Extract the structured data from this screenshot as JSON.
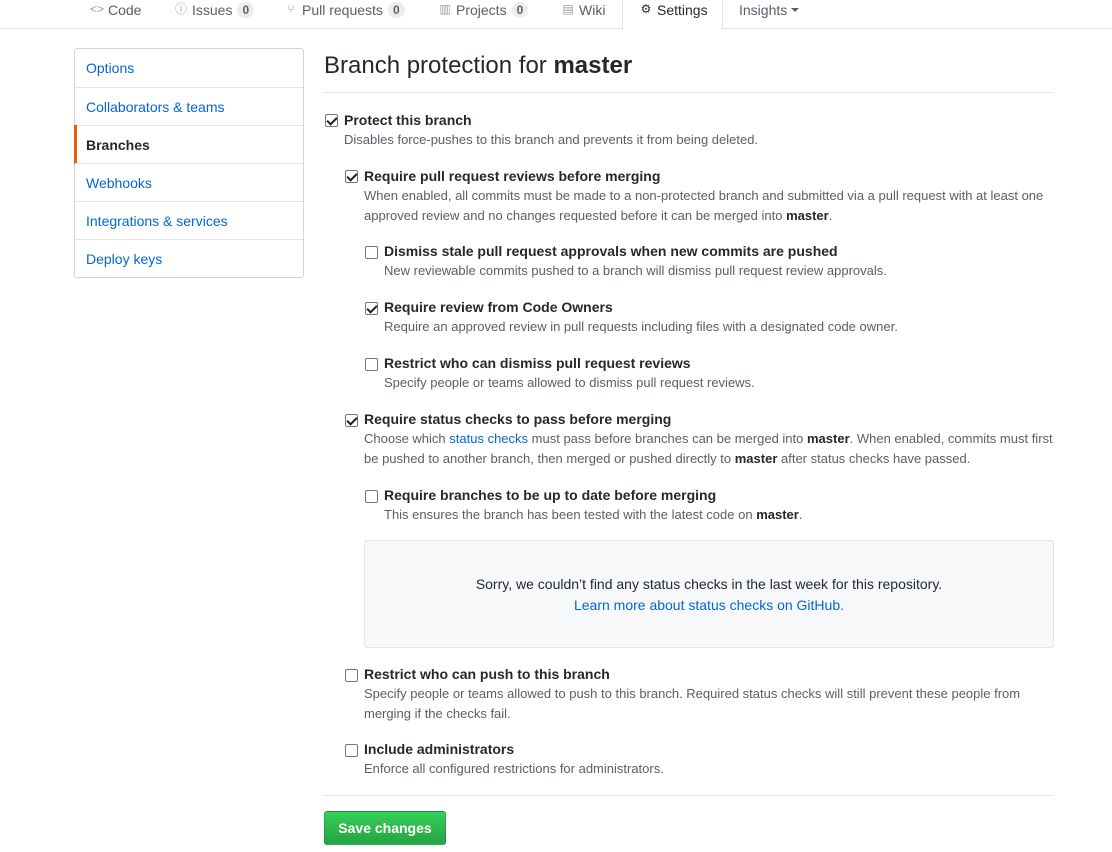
{
  "nav": {
    "tabs": [
      {
        "label": "Code",
        "icon": "code-icon"
      },
      {
        "label": "Issues",
        "icon": "issue-icon",
        "count": "0"
      },
      {
        "label": "Pull requests",
        "icon": "pull-request-icon",
        "count": "0"
      },
      {
        "label": "Projects",
        "icon": "project-icon",
        "count": "0"
      },
      {
        "label": "Wiki",
        "icon": "book-icon"
      },
      {
        "label": "Settings",
        "icon": "gear-icon",
        "selected": true
      },
      {
        "label": "Insights",
        "icon": "chevron-down-icon"
      }
    ]
  },
  "sidebar": {
    "items": [
      {
        "label": "Options"
      },
      {
        "label": "Collaborators & teams"
      },
      {
        "label": "Branches",
        "active": true
      },
      {
        "label": "Webhooks"
      },
      {
        "label": "Integrations & services"
      },
      {
        "label": "Deploy keys"
      }
    ]
  },
  "main": {
    "heading_prefix": "Branch protection for ",
    "heading_branch": "master",
    "options": {
      "protect": {
        "title": "Protect this branch",
        "checked": true,
        "note": "Disables force-pushes to this branch and prevents it from being deleted."
      },
      "reviews": {
        "title": "Require pull request reviews before merging",
        "checked": true,
        "note_a": "When enabled, all commits must be made to a non-protected branch and submitted via a pull request with at least one approved review and no changes requested before it can be merged into ",
        "note_b": "master",
        "note_c": "."
      },
      "dismiss_stale": {
        "title": "Dismiss stale pull request approvals when new commits are pushed",
        "checked": false,
        "note": "New reviewable commits pushed to a branch will dismiss pull request review approvals."
      },
      "code_owners": {
        "title": "Require review from Code Owners",
        "checked": true,
        "note": "Require an approved review in pull requests including files with a designated code owner."
      },
      "restrict_dismiss": {
        "title": "Restrict who can dismiss pull request reviews",
        "checked": false,
        "note": "Specify people or teams allowed to dismiss pull request reviews."
      },
      "status_checks": {
        "title": "Require status checks to pass before merging",
        "checked": true,
        "note_a": "Choose which ",
        "note_link": "status checks",
        "note_b": " must pass before branches can be merged into ",
        "note_c": "master",
        "note_d": ". When enabled, commits must first be pushed to another branch, then merged or pushed directly to ",
        "note_e": "master",
        "note_f": " after status checks have passed."
      },
      "up_to_date": {
        "title": "Require branches to be up to date before merging",
        "checked": false,
        "note_a": "This ensures the branch has been tested with the latest code on ",
        "note_b": "master",
        "note_c": "."
      },
      "restrict_push": {
        "title": "Restrict who can push to this branch",
        "checked": false,
        "note": "Specify people or teams allowed to push to this branch. Required status checks will still prevent these people from merging if the checks fail."
      },
      "admins": {
        "title": "Include administrators",
        "checked": false,
        "note": "Enforce all configured restrictions for administrators."
      }
    },
    "blankslate": {
      "message": "Sorry, we couldn’t find any status checks in the last week for this repository.",
      "link": "Learn more about status checks on GitHub."
    },
    "save_label": "Save changes",
    "save_color": "#28a745"
  }
}
